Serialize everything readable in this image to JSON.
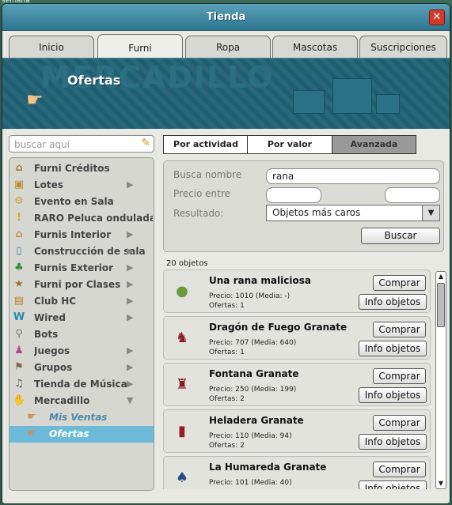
{
  "background_label": "semana",
  "window": {
    "title": "Tienda",
    "close_label": "✕"
  },
  "tabs": [
    {
      "label": "Inicio"
    },
    {
      "label": "Furni"
    },
    {
      "label": "Ropa"
    },
    {
      "label": "Mascotas"
    },
    {
      "label": "Suscripciones"
    }
  ],
  "active_tab": "Furni",
  "banner": {
    "title": "Ofertas",
    "backdrop_word": "MERCADILLO"
  },
  "search": {
    "placeholder": "buscar aquí"
  },
  "categories": [
    {
      "label": "Furni Créditos",
      "icon": "chair-icon",
      "has_children": false
    },
    {
      "label": "Lotes",
      "icon": "box-icon",
      "has_children": true
    },
    {
      "label": "Evento en Sala",
      "icon": "gear-icon",
      "has_children": false
    },
    {
      "label": "RARO Peluca ondulada lar",
      "icon": "exclamation-icon",
      "has_children": false
    },
    {
      "label": "Furnis Interior",
      "icon": "roof-icon",
      "has_children": true
    },
    {
      "label": "Construcción de sala",
      "icon": "frame-icon",
      "has_children": true
    },
    {
      "label": "Furnis Exterior",
      "icon": "plant-icon",
      "has_children": true
    },
    {
      "label": "Furni por Clases",
      "icon": "star-icon",
      "has_children": true
    },
    {
      "label": "Club HC",
      "icon": "hc-icon",
      "has_children": true
    },
    {
      "label": "Wired",
      "icon": "wired-icon",
      "has_children": true
    },
    {
      "label": "Bots",
      "icon": "bot-icon",
      "has_children": false
    },
    {
      "label": "Juegos",
      "icon": "joystick-icon",
      "has_children": true
    },
    {
      "label": "Grupos",
      "icon": "group-icon",
      "has_children": true
    },
    {
      "label": "Tienda de Música",
      "icon": "music-icon",
      "has_children": true
    },
    {
      "label": "Mercadillo",
      "icon": "market-icon",
      "has_children": true,
      "expanded": true
    }
  ],
  "subcategories": [
    {
      "label": "Mis Ventas",
      "icon": "hand-icon"
    },
    {
      "label": "Ofertas",
      "icon": "hand-icon",
      "selected": true
    }
  ],
  "sort_tabs": [
    {
      "label": "Por actividad"
    },
    {
      "label": "Por valor"
    },
    {
      "label": "Avanzada",
      "active": true
    }
  ],
  "filter": {
    "name_label": "Busca nombre",
    "name_value": "rana",
    "price_label": "Precio entre",
    "price_min": "",
    "price_max": "",
    "result_label": "Resultado:",
    "result_value": "Objetos más caros",
    "search_button": "Buscar"
  },
  "results_count": "20 objetos",
  "buy_label": "Comprar",
  "info_label": "Info objetos",
  "results": [
    {
      "name": "Una rana maliciosa",
      "price": "Precio: 1010 (Media:  -)",
      "offers": "Ofertas: 1",
      "icon": "frog-icon",
      "color": "#6a9a3a"
    },
    {
      "name": "Dragón de Fuego Granate",
      "price": "Precio: 707 (Media: 640)",
      "offers": "Ofertas: 1",
      "icon": "dragon-icon",
      "color": "#8b1a22"
    },
    {
      "name": "Fontana Granate",
      "price": "Precio: 250 (Media: 199)",
      "offers": "Ofertas: 2",
      "icon": "fountain-icon",
      "color": "#8b1a22"
    },
    {
      "name": "Heladera Granate",
      "price": "Precio: 110 (Media: 94)",
      "offers": "Ofertas: 2",
      "icon": "fridge-icon",
      "color": "#9b1a2a"
    },
    {
      "name": "La Humareda Granate",
      "price": "Precio: 101 (Media: 40)",
      "offers": "",
      "icon": "smoke-icon",
      "color": "#2a4a8a"
    }
  ]
}
